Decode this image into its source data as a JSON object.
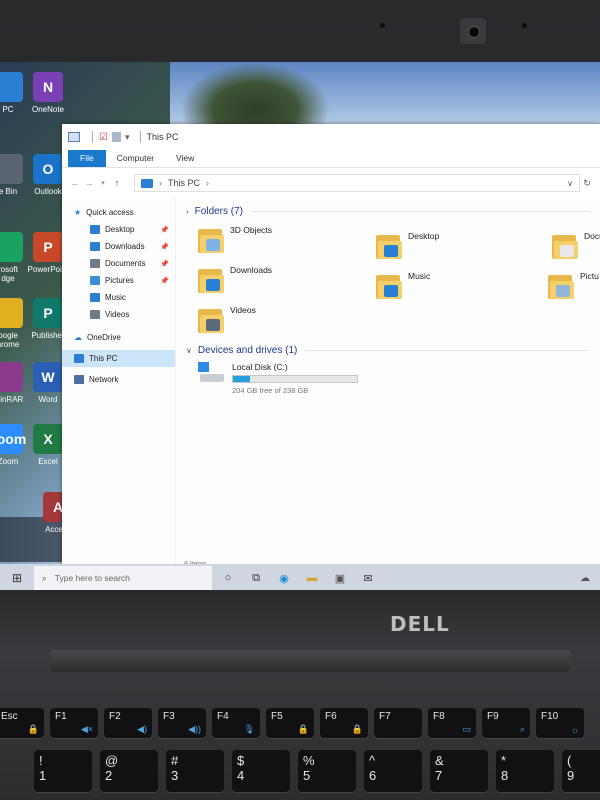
{
  "brand": {
    "laptop_logo": "DØLL"
  },
  "desktop_icons": [
    {
      "label": "PC",
      "glyph": "",
      "color": "#2a7fd4"
    },
    {
      "label": "OneNote",
      "glyph": "N",
      "color": "#7a3fb5"
    },
    {
      "label": "e Bin",
      "glyph": "",
      "color": "#5a6470"
    },
    {
      "label": "Outlook",
      "glyph": "O",
      "color": "#1a73c8"
    },
    {
      "label": "rosoft\ndge",
      "glyph": "",
      "color": "#1aa260"
    },
    {
      "label": "PowerPoint",
      "glyph": "P",
      "color": "#c8482a"
    },
    {
      "label": "oogle\nhrome",
      "glyph": "",
      "color": "#e0b020"
    },
    {
      "label": "Publisher",
      "glyph": "P",
      "color": "#0f7a6a"
    },
    {
      "label": "WinRAR",
      "glyph": "",
      "color": "#8a3a8a"
    },
    {
      "label": "Word",
      "glyph": "W",
      "color": "#2b5fb5"
    },
    {
      "label": "Zoom",
      "glyph": "zoom",
      "color": "#2d8cff"
    },
    {
      "label": "Excel",
      "glyph": "X",
      "color": "#1f7a44"
    },
    {
      "label": "Access",
      "glyph": "A",
      "color": "#a4373a"
    }
  ],
  "explorer": {
    "title": "This PC",
    "ribbon_tabs": [
      "File",
      "Computer",
      "View"
    ],
    "address": "This PC",
    "nav": {
      "quick_access": "Quick access",
      "items": [
        {
          "label": "Desktop",
          "color": "#2a7fd4",
          "pinned": true
        },
        {
          "label": "Downloads",
          "color": "#2a7fd4",
          "pinned": true
        },
        {
          "label": "Documents",
          "color": "#6e7b8a",
          "pinned": true
        },
        {
          "label": "Pictures",
          "color": "#3b8fd8",
          "pinned": true
        },
        {
          "label": "Music",
          "color": "#2a7fd4",
          "pinned": false
        },
        {
          "label": "Videos",
          "color": "#6e7b8a",
          "pinned": false
        }
      ],
      "onedrive": "OneDrive",
      "this_pc": "This PC",
      "network": "Network"
    },
    "folders_header": "Folders (7)",
    "folders": [
      {
        "label": "3D Objects",
        "badge": "#7fb3e6"
      },
      {
        "label": "Desktop",
        "badge": "#2a7fd4"
      },
      {
        "label": "Docu",
        "badge": "#e8e8e8"
      },
      {
        "label": "Downloads",
        "badge": "#2a7fd4"
      },
      {
        "label": "Music",
        "badge": "#2a7fd4"
      },
      {
        "label": "Pictu",
        "badge": "#8fb8d8"
      },
      {
        "label": "Videos",
        "badge": "#5a6a7a"
      }
    ],
    "drives_header": "Devices and drives (1)",
    "drive": {
      "label": "Local Disk (C:)",
      "free_text": "204 GB free of 238 GB",
      "used_fraction": 0.14
    },
    "status": "8 items"
  },
  "taskbar": {
    "search_placeholder": "Type here to search"
  },
  "keyboard": {
    "fn_keys": [
      {
        "label": "Esc",
        "sub": "🔒"
      },
      {
        "label": "F1",
        "sub": "◀×"
      },
      {
        "label": "F2",
        "sub": "◀)"
      },
      {
        "label": "F3",
        "sub": "◀))"
      },
      {
        "label": "F4",
        "sub": "🎙"
      },
      {
        "label": "F5",
        "sub": "🔒"
      },
      {
        "label": "F6",
        "sub": "🔒"
      },
      {
        "label": "F7",
        "sub": ""
      },
      {
        "label": "F8",
        "sub": "▭"
      },
      {
        "label": "F9",
        "sub": "⌕"
      },
      {
        "label": "F10",
        "sub": "☼"
      }
    ],
    "num_keys": [
      {
        "top": "!",
        "bottom": "1"
      },
      {
        "top": "@",
        "bottom": "2"
      },
      {
        "top": "#",
        "bottom": "3"
      },
      {
        "top": "$",
        "bottom": "4"
      },
      {
        "top": "%",
        "bottom": "5"
      },
      {
        "top": "^",
        "bottom": "6"
      },
      {
        "top": "&",
        "bottom": "7"
      },
      {
        "top": "*",
        "bottom": "8"
      },
      {
        "top": "(",
        "bottom": "9"
      }
    ]
  }
}
